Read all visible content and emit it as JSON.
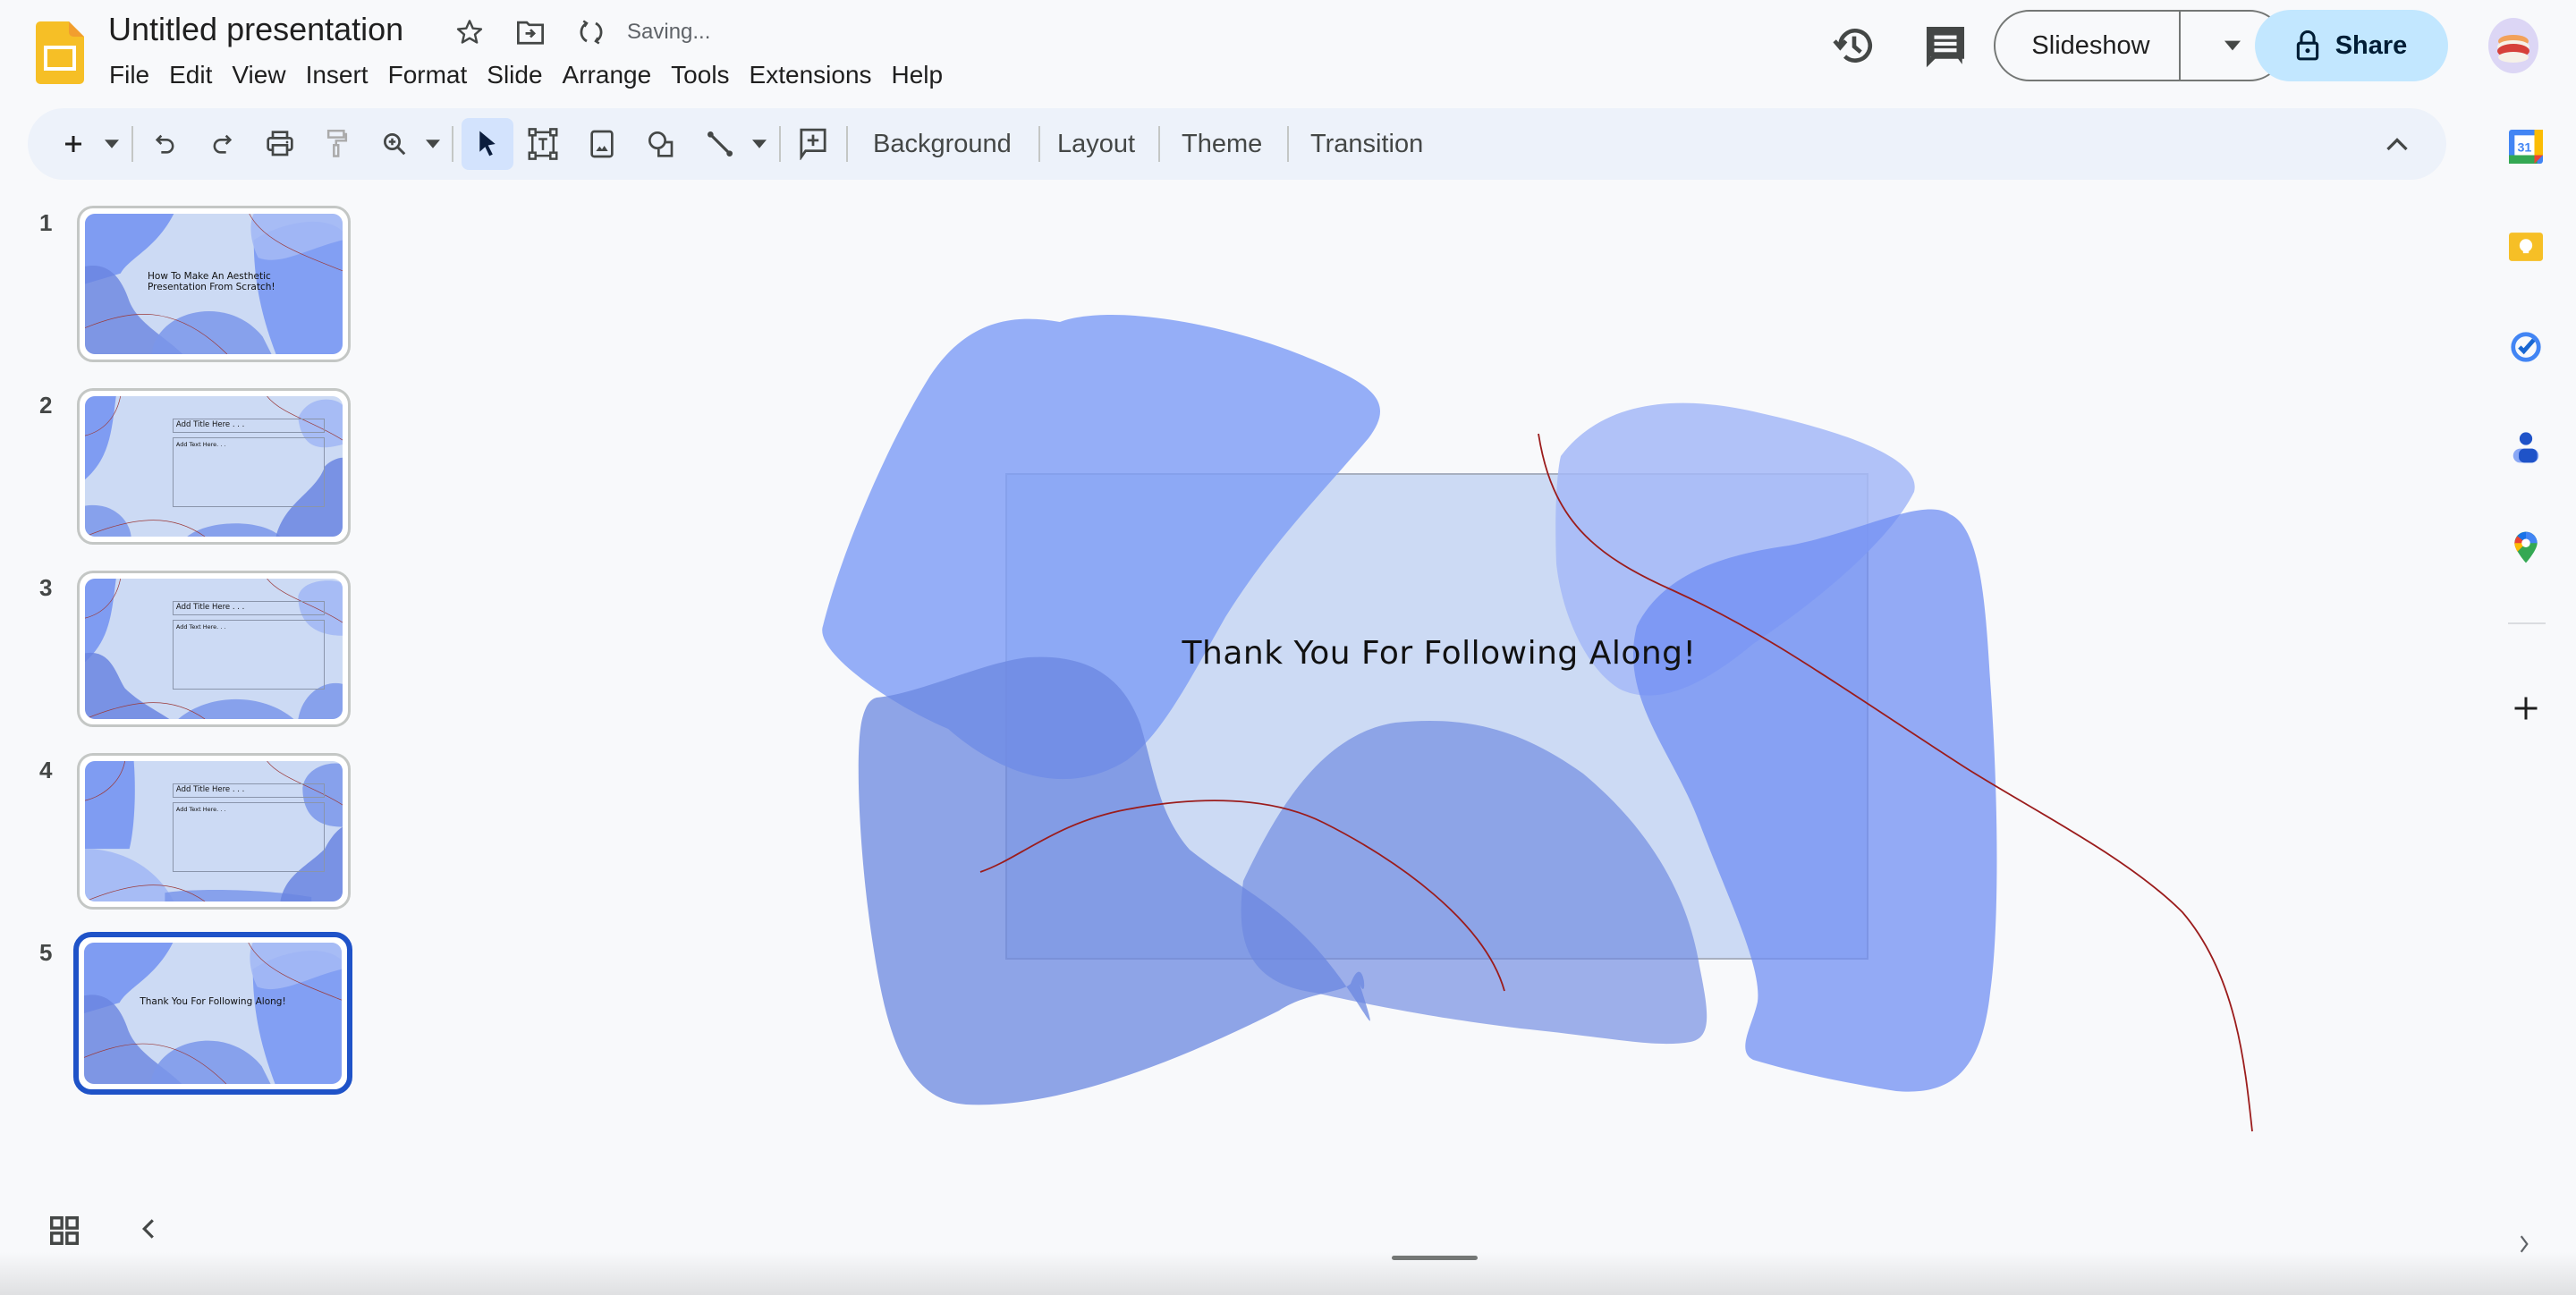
{
  "app": {
    "name": "Google Slides",
    "document_title": "Untitled presentation",
    "save_status": "Saving...",
    "icons": {
      "logo": "slides-logo-icon",
      "star": "star-icon",
      "move": "move-to-folder-icon",
      "sync": "sync-icon"
    }
  },
  "menu": [
    "File",
    "Edit",
    "View",
    "Insert",
    "Format",
    "Slide",
    "Arrange",
    "Tools",
    "Extensions",
    "Help"
  ],
  "header_actions": {
    "version_history_icon": "history-icon",
    "comments_icon": "comment-icon",
    "slideshow_label": "Slideshow",
    "share_label": "Share",
    "share_icon": "lock-icon",
    "share_bg": "#c2e7ff",
    "avatar_icon": "avatar-sushi"
  },
  "toolbar": {
    "tools": [
      {
        "name": "new-slide",
        "icon": "plus-icon"
      },
      {
        "name": "new-slide-menu",
        "icon": "caret-down-icon"
      },
      {
        "name": "undo",
        "icon": "undo-icon"
      },
      {
        "name": "redo",
        "icon": "redo-icon"
      },
      {
        "name": "print",
        "icon": "print-icon"
      },
      {
        "name": "paint-format",
        "icon": "paint-roller-icon"
      },
      {
        "name": "zoom",
        "icon": "zoom-in-icon"
      },
      {
        "name": "zoom-menu",
        "icon": "caret-down-icon"
      },
      {
        "name": "select",
        "icon": "cursor-icon",
        "active": true
      },
      {
        "name": "text-box",
        "icon": "text-box-icon"
      },
      {
        "name": "image",
        "icon": "image-icon"
      },
      {
        "name": "shape",
        "icon": "shape-icon"
      },
      {
        "name": "line",
        "icon": "line-icon"
      },
      {
        "name": "line-menu",
        "icon": "caret-down-icon"
      },
      {
        "name": "comment",
        "icon": "add-comment-icon"
      }
    ],
    "background_label": "Background",
    "layout_label": "Layout",
    "theme_label": "Theme",
    "transition_label": "Transition",
    "collapse_icon": "chevron-up-icon",
    "select_highlight": "#d3e3fd"
  },
  "slides": [
    {
      "number": "1",
      "title": "How To Make An Aesthetic Presentation From Scratch!",
      "type": "title"
    },
    {
      "number": "2",
      "title": "Add Title Here . . .",
      "body": "Add Text Here. . .",
      "type": "content"
    },
    {
      "number": "3",
      "title": "Add Title Here . . .",
      "body": "Add Text Here. . .",
      "type": "content"
    },
    {
      "number": "4",
      "title": "Add Title Here . . .",
      "body": "Add Text Here. . .",
      "type": "content"
    },
    {
      "number": "5",
      "title": "Thank You For Following Along!",
      "type": "title",
      "selected": true
    }
  ],
  "current_slide": {
    "number": "5",
    "text": "Thank You For Following Along!",
    "background": "#ccdaf4",
    "shape_colors": [
      "#7f9cf5",
      "#6a86e3",
      "#a4b9f7",
      "#6c8af2",
      "#5a7ee6"
    ],
    "curve_color": "#9b1c1c"
  },
  "side_panel": {
    "apps": [
      {
        "name": "Calendar",
        "icon": "calendar-icon",
        "label": "31"
      },
      {
        "name": "Keep",
        "icon": "keep-icon"
      },
      {
        "name": "Tasks",
        "icon": "tasks-icon"
      },
      {
        "name": "Contacts",
        "icon": "contacts-icon"
      },
      {
        "name": "Maps",
        "icon": "maps-icon"
      }
    ],
    "add_icon": "plus-icon"
  },
  "bottom": {
    "grid_view_icon": "grid-view-icon",
    "collapse_filmstrip_icon": "chevron-left-icon",
    "speaker_notes_handle": "drag-handle",
    "expand_side_panel_icon": "chevron-right-icon"
  },
  "accent": "#1f53c8"
}
